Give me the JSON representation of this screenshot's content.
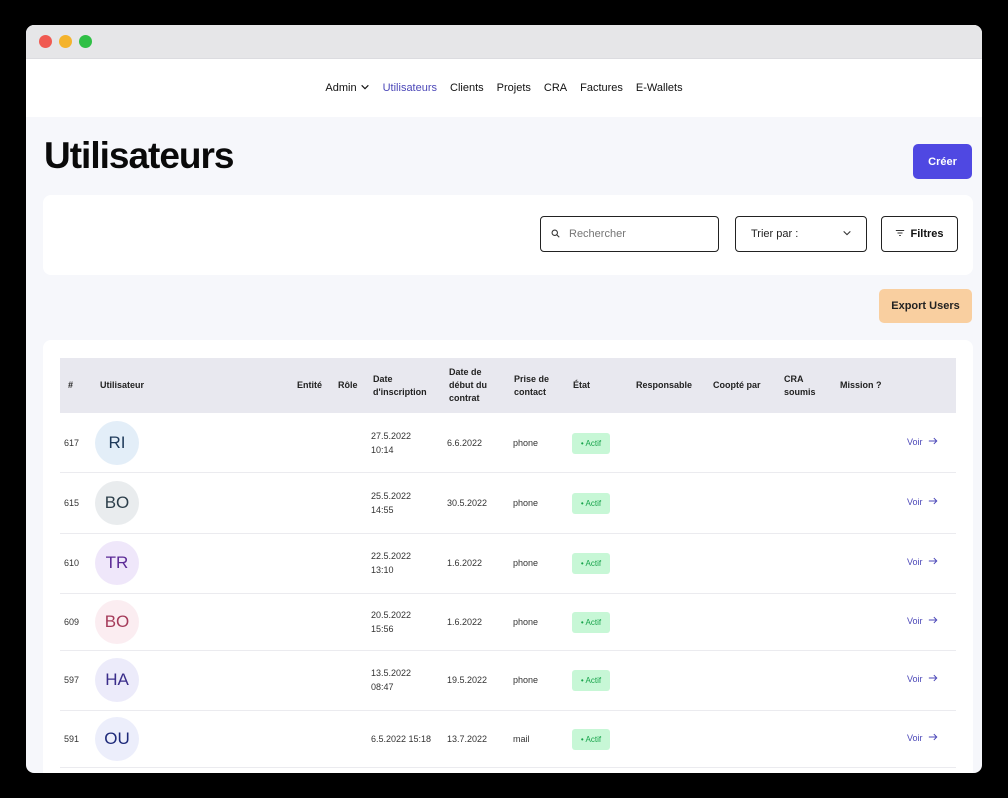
{
  "nav": {
    "items": [
      {
        "label": "Admin",
        "dropdown": true
      },
      {
        "label": "Utilisateurs",
        "active": true
      },
      {
        "label": "Clients"
      },
      {
        "label": "Projets"
      },
      {
        "label": "CRA"
      },
      {
        "label": "Factures"
      },
      {
        "label": "E-Wallets"
      }
    ]
  },
  "page": {
    "title": "Utilisateurs",
    "create_label": "Créer",
    "export_label": "Export Users"
  },
  "filters": {
    "search_placeholder": "Rechercher",
    "sort_label": "Trier par :",
    "filter_label": "Filtres"
  },
  "colors": {
    "accent": "#4f48e2",
    "export": "#f9cfa0",
    "badge_bg": "#c7f7d6",
    "badge_text": "#16a34a"
  },
  "table": {
    "headers": {
      "num": "#",
      "user": "Utilisateur",
      "entity": "Entité",
      "role": "Rôle",
      "signup": "Date d'inscription",
      "start": "Date de début du contrat",
      "contact": "Prise de contact",
      "state": "État",
      "manager": "Responsable",
      "coopted": "Coopté par",
      "cra": "CRA soumis",
      "mission": "Mission ?"
    },
    "rows": [
      {
        "id": "617",
        "initials": "RI",
        "avatar_bg": "#e3eef8",
        "avatar_fg": "#1f3a5a",
        "signup": "27.5.2022 10:14",
        "start": "6.6.2022",
        "contact": "phone",
        "state": "• Actif",
        "action": "Voir"
      },
      {
        "id": "615",
        "initials": "BO",
        "avatar_bg": "#e9ecee",
        "avatar_fg": "#2c3e4a",
        "signup": "25.5.2022 14:55",
        "start": "30.5.2022",
        "contact": "phone",
        "state": "• Actif",
        "action": "Voir"
      },
      {
        "id": "610",
        "initials": "TR",
        "avatar_bg": "#efe7fa",
        "avatar_fg": "#5b2a96",
        "signup": "22.5.2022 13:10",
        "start": "1.6.2022",
        "contact": "phone",
        "state": "• Actif",
        "action": "Voir"
      },
      {
        "id": "609",
        "initials": "BO",
        "avatar_bg": "#fbedf1",
        "avatar_fg": "#a53b5a",
        "signup": "20.5.2022 15:56",
        "start": "1.6.2022",
        "contact": "phone",
        "state": "• Actif",
        "action": "Voir"
      },
      {
        "id": "597",
        "initials": "HA",
        "avatar_bg": "#ecebfa",
        "avatar_fg": "#3a2d8a",
        "signup": "13.5.2022 08:47",
        "start": "19.5.2022",
        "contact": "phone",
        "state": "• Actif",
        "action": "Voir"
      },
      {
        "id": "591",
        "initials": "OU",
        "avatar_bg": "#eceefb",
        "avatar_fg": "#1e2a7a",
        "signup": "6.5.2022 15:18",
        "start": "13.7.2022",
        "contact": "mail",
        "state": "• Actif",
        "action": "Voir"
      }
    ]
  }
}
